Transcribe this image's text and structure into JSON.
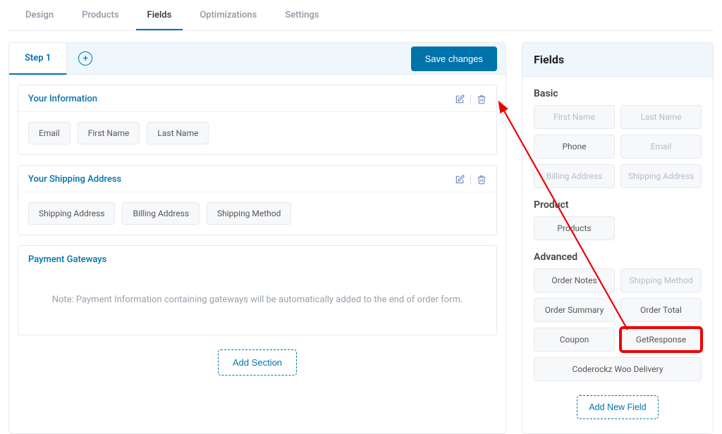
{
  "tabs": {
    "design": "Design",
    "products": "Products",
    "fields": "Fields",
    "optimizations": "Optimizations",
    "settings": "Settings"
  },
  "stepBar": {
    "step1": "Step 1",
    "save": "Save changes"
  },
  "sections": {
    "info": {
      "title": "Your Information",
      "chips": {
        "email": "Email",
        "first": "First Name",
        "last": "Last Name"
      }
    },
    "shipping": {
      "title": "Your Shipping Address",
      "chips": {
        "shipAddr": "Shipping Address",
        "billAddr": "Billing Address",
        "shipMethod": "Shipping Method"
      }
    },
    "payment": {
      "title": "Payment Gateways",
      "note": "Note: Payment Information containing gateways will be automatically added to the end of order form."
    }
  },
  "addSection": "Add Section",
  "panel": {
    "title": "Fields",
    "basic": {
      "label": "Basic",
      "first": "First Name",
      "last": "Last Name",
      "phone": "Phone",
      "email": "Email",
      "billAddr": "Billing Address",
      "shipAddr": "Shipping Address"
    },
    "product": {
      "label": "Product",
      "products": "Products"
    },
    "advanced": {
      "label": "Advanced",
      "orderNotes": "Order Notes",
      "shipMethod": "Shipping Method",
      "orderSummary": "Order Summary",
      "orderTotal": "Order Total",
      "coupon": "Coupon",
      "getresponse": "GetResponse",
      "coderockz": "Coderockz Woo Delivery"
    },
    "addField": "Add New Field"
  }
}
